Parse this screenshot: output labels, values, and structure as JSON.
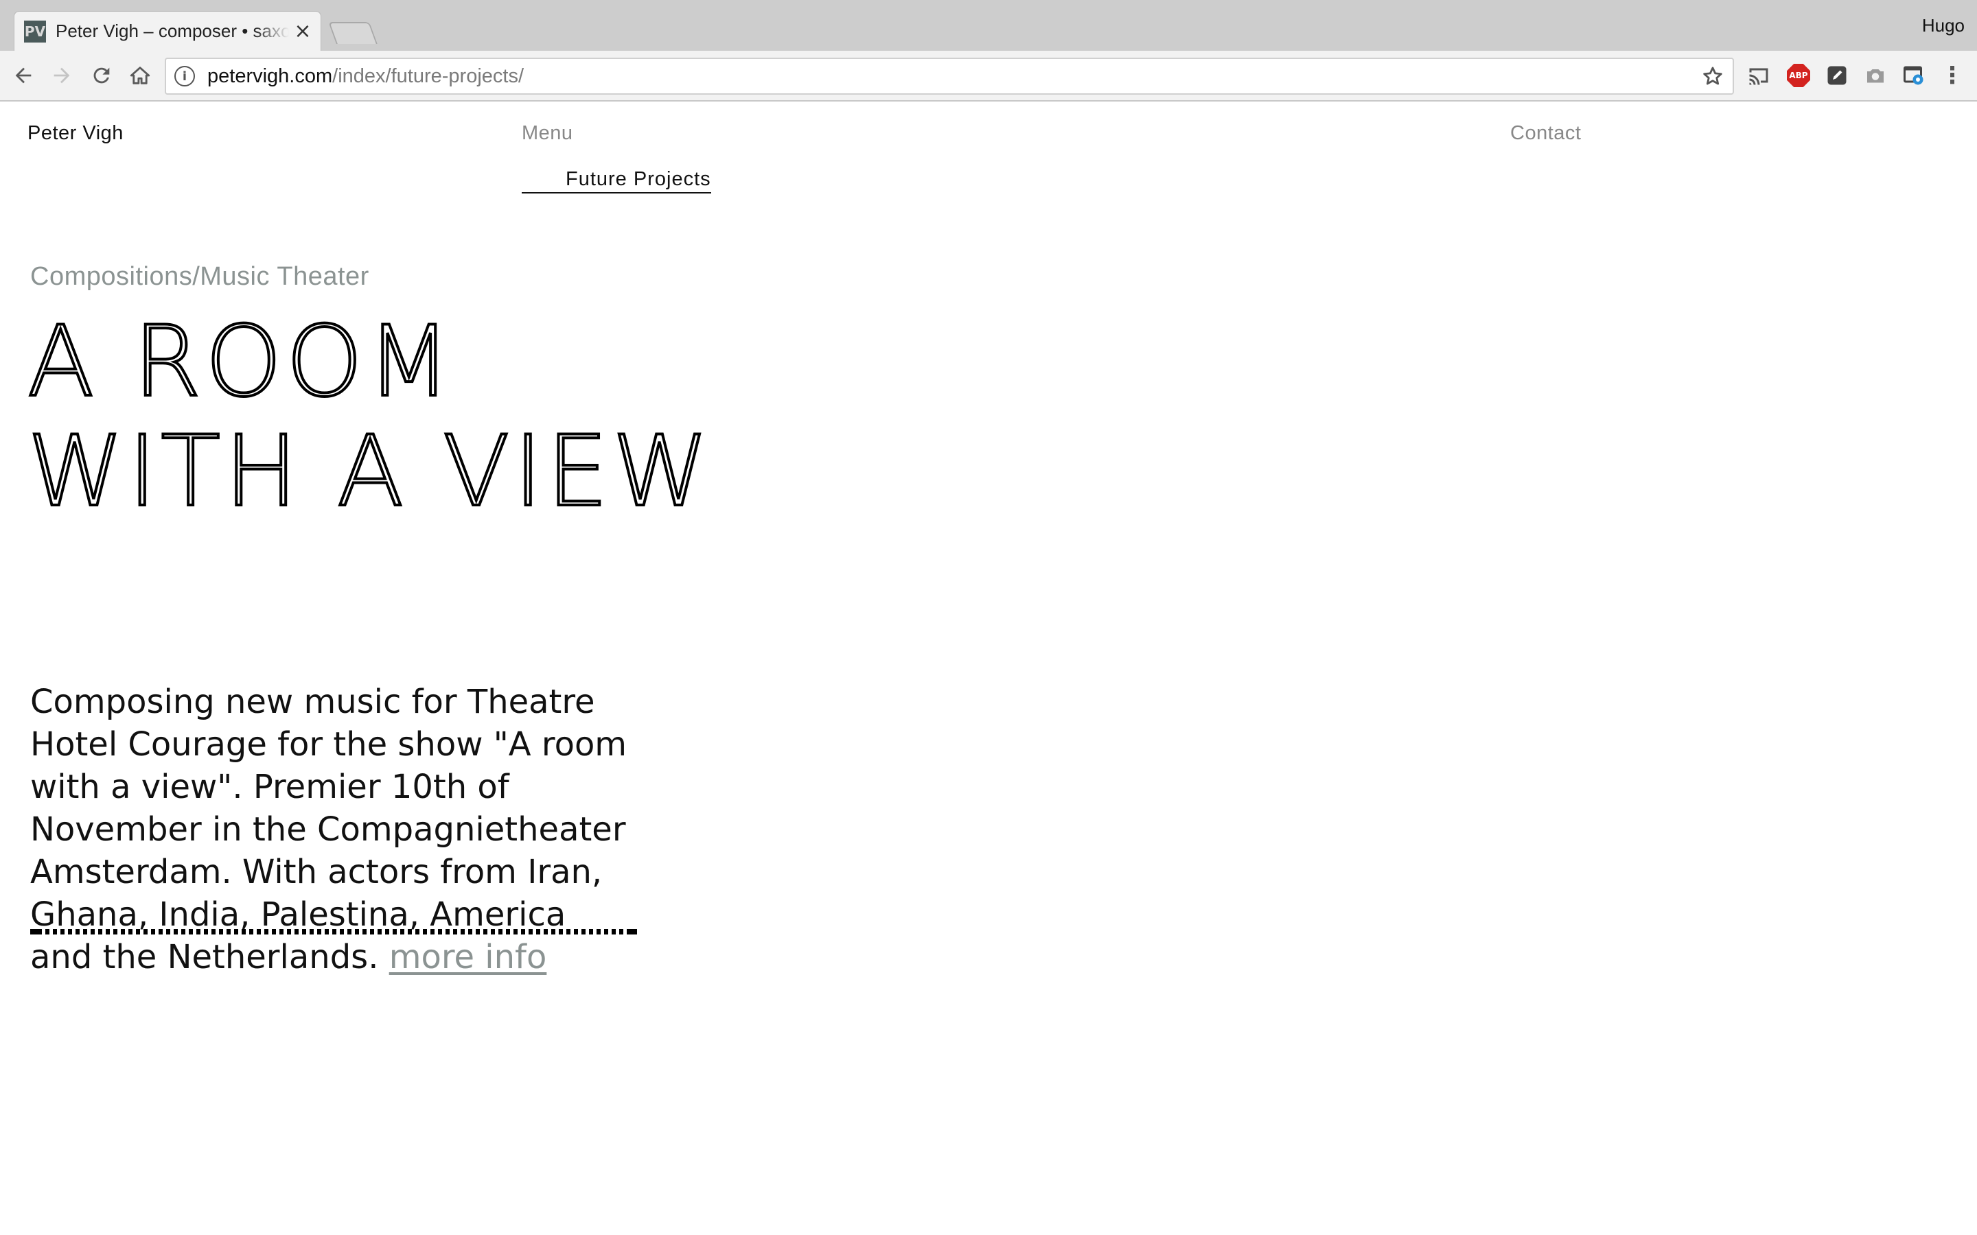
{
  "browser": {
    "tab": {
      "favicon_text": "PV",
      "title": "Peter Vigh – composer • saxophonist",
      "close_glyph": "×"
    },
    "profile_name": "Hugo",
    "address": {
      "host": "petervigh.com",
      "path": "/index/future-projects/"
    },
    "extensions": {
      "abp_label": "ABP"
    },
    "menu_glyph": "⋮"
  },
  "site": {
    "name": "Peter Vigh",
    "nav": {
      "menu": "Menu",
      "contact": "Contact",
      "current_section": "Future Projects"
    }
  },
  "project": {
    "category": "Compositions/Music Theater",
    "title_line1": "A ROOM",
    "title_line2": "WITH A VIEW",
    "description": "Composing new music for Theatre Hotel Courage for the show \"A room with a view\". Premier 10th of November in the Compagnietheater Amsterdam. With actors from Iran, Ghana, India, Palestina, America and the Netherlands. ",
    "more_link": "more info"
  },
  "colors": {
    "muted_text": "#8b9392",
    "body_text": "#111111",
    "chrome_bg": "#f2f2f2",
    "tabstrip_bg": "#cdcdcd",
    "abp_red": "#d3231f"
  }
}
